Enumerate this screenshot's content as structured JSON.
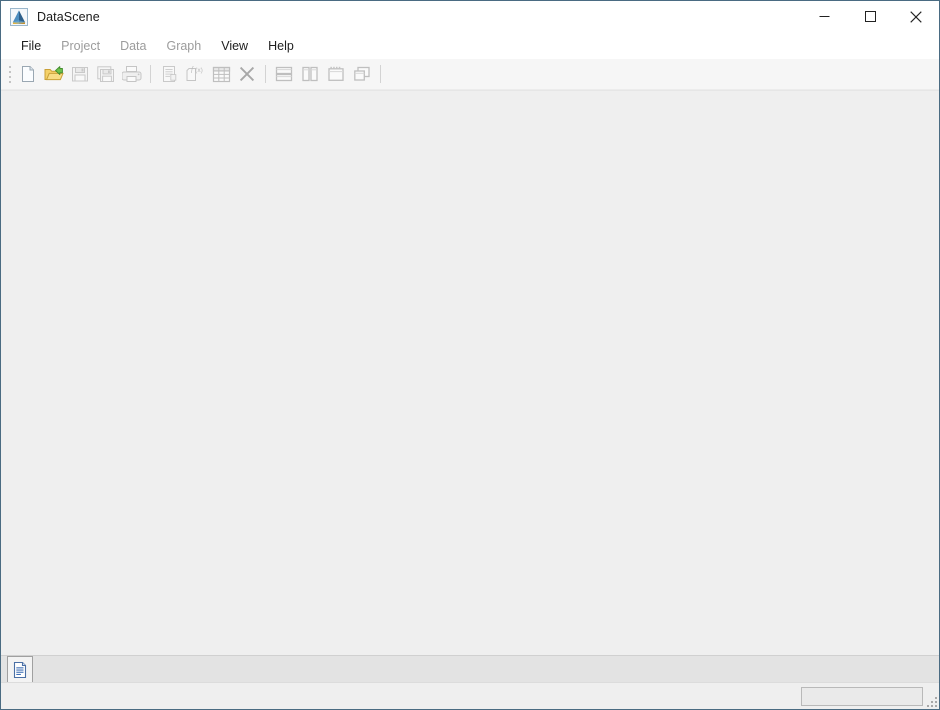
{
  "window": {
    "title": "DataScene",
    "app_icon": "datascene-logo-icon",
    "border_color": "#4a6b82",
    "controls": {
      "minimize": "Minimize",
      "maximize": "Maximize",
      "close": "Close"
    }
  },
  "menu": {
    "items": [
      {
        "label": "File",
        "enabled": true
      },
      {
        "label": "Project",
        "enabled": false
      },
      {
        "label": "Data",
        "enabled": false
      },
      {
        "label": "Graph",
        "enabled": false
      },
      {
        "label": "View",
        "enabled": true
      },
      {
        "label": "Help",
        "enabled": true
      }
    ]
  },
  "toolbar": {
    "grip": "toolbar-drag-grip",
    "buttons": [
      {
        "name": "new-document-button",
        "icon": "new-document-icon",
        "tooltip": "New",
        "enabled": true,
        "type": "button"
      },
      {
        "name": "open-project-button",
        "icon": "open-folder-icon",
        "tooltip": "Open",
        "enabled": true,
        "type": "button"
      },
      {
        "name": "save-button",
        "icon": "save-floppy-icon",
        "tooltip": "Save",
        "enabled": false,
        "type": "button"
      },
      {
        "name": "save-all-button",
        "icon": "save-all-icon",
        "tooltip": "Save All",
        "enabled": false,
        "type": "button"
      },
      {
        "name": "print-button",
        "icon": "printer-icon",
        "tooltip": "Print",
        "enabled": false,
        "type": "button"
      },
      {
        "name": "toolbar-separator-1",
        "icon": "separator",
        "tooltip": "",
        "enabled": false,
        "type": "separator"
      },
      {
        "name": "new-report-button",
        "icon": "report-document-icon",
        "tooltip": "New Report",
        "enabled": false,
        "type": "button"
      },
      {
        "name": "function-button",
        "icon": "function-fx-icon",
        "tooltip": "Function",
        "enabled": false,
        "type": "button"
      },
      {
        "name": "data-table-button",
        "icon": "data-grid-icon",
        "tooltip": "Data Table",
        "enabled": false,
        "type": "button"
      },
      {
        "name": "close-window-button",
        "icon": "close-x-icon",
        "tooltip": "Close",
        "enabled": false,
        "type": "button"
      },
      {
        "name": "toolbar-separator-2",
        "icon": "separator",
        "tooltip": "",
        "enabled": false,
        "type": "separator"
      },
      {
        "name": "tile-horizontal-button",
        "icon": "tile-horizontal-icon",
        "tooltip": "Tile Horizontal",
        "enabled": false,
        "type": "button"
      },
      {
        "name": "tile-vertical-button",
        "icon": "tile-vertical-icon",
        "tooltip": "Tile Vertical",
        "enabled": false,
        "type": "button"
      },
      {
        "name": "cascade-button",
        "icon": "cascade-windows-icon",
        "tooltip": "Cascade",
        "enabled": false,
        "type": "button"
      },
      {
        "name": "arrange-icons-button",
        "icon": "arrange-windows-icon",
        "tooltip": "Arrange",
        "enabled": false,
        "type": "button"
      },
      {
        "name": "toolbar-separator-3",
        "icon": "separator",
        "tooltip": "",
        "enabled": false,
        "type": "separator"
      }
    ]
  },
  "workspace": {
    "background": "#efefef",
    "content": ""
  },
  "tab_strip": {
    "tabs": [
      {
        "name": "document-tab",
        "icon": "document-lines-icon",
        "label": "",
        "active": true
      }
    ]
  },
  "status_bar": {
    "message": "",
    "panel_text": "",
    "resize_grip": "resize-grip-icon"
  }
}
